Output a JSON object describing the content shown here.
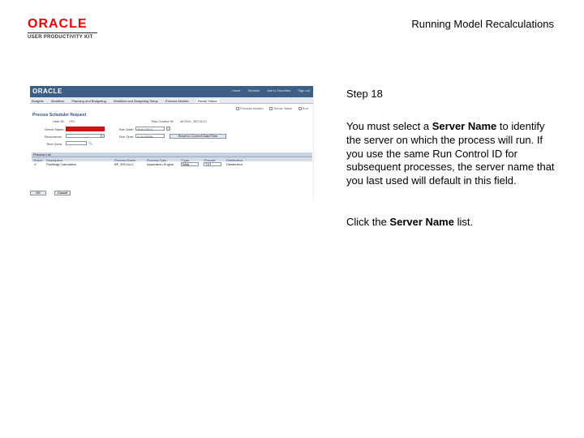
{
  "header": {
    "logo_main": "ORACLE",
    "logo_sub": "USER PRODUCTIVITY KIT",
    "title": "Running Model Recalculations"
  },
  "screenshot": {
    "app_logo": "ORACLE",
    "topbar_links": [
      "Home",
      "Worklist",
      "Add to Favorites",
      "Sign out"
    ],
    "menu_tabs": [
      "Budgets",
      "Workflow",
      "Planning and Budgeting",
      "Workflow and Budgeting Setup",
      "Process Monitor",
      "Recall Status"
    ],
    "options": [
      "Process Monitor",
      "Server Name",
      "Run"
    ],
    "page_title": "Process Scheduler Request",
    "form": {
      "user_id_label": "User ID:",
      "user_id_value": "VP1",
      "run_control_label": "Run Control ID:",
      "run_control_value": "MODEL_RECALC",
      "server_name_label": "Server Name:",
      "run_date_label": "Run Date:",
      "run_date_value": "09/11/2011",
      "recurrence_label": "Recurrence:",
      "run_time_label": "Run Time:",
      "run_time_value": "3:29:30PM",
      "time_zone_label": "Time Zone:",
      "reset_button": "Reset to Current Date/Time"
    },
    "process_list": {
      "title": "Process List",
      "columns": [
        "Select",
        "Description",
        "Process Name",
        "Process Type",
        "*Type",
        "*Format",
        "Distribution"
      ],
      "rows": [
        {
          "select": "✔",
          "description": "PlanBdgt Calculation",
          "process_name": "BP_RECALC",
          "process_type": "Application Engine",
          "type": "Web",
          "format": "TXT",
          "distribution": "Distribution"
        }
      ]
    },
    "ok_button": "OK",
    "cancel_button": "Cancel"
  },
  "instructions": {
    "step": "Step 18",
    "text_1": "You must select a ",
    "bold_1": "Server Name",
    "text_2": " to identify the server on which the process will run. If you use the same Run Control ID for subsequent processes, the server name that you last used will default in this field.",
    "click_prefix": "Click the ",
    "click_bold": "Server Name",
    "click_suffix": " list."
  },
  "colors": {
    "highlight": "#c41818",
    "topbar": "#3d5f86",
    "logo_red": "#ee0000"
  }
}
